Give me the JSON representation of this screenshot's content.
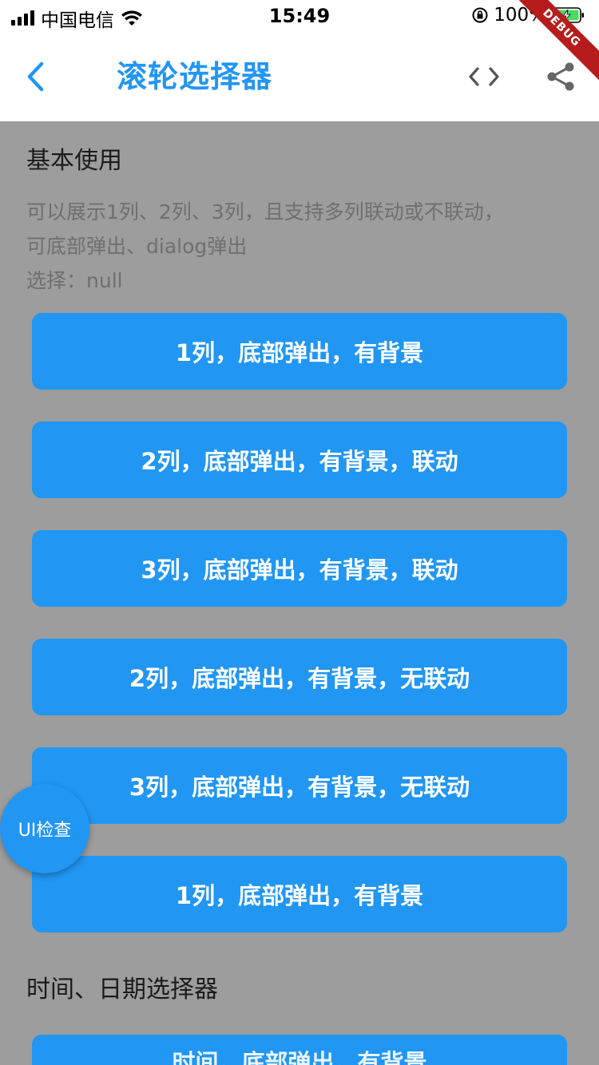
{
  "status": {
    "carrier": "中国电信",
    "time": "15:49",
    "battery": "100%"
  },
  "appbar": {
    "title": "滚轮选择器"
  },
  "debug_label": "DEBUG",
  "section_basic": {
    "title": "基本使用",
    "desc_line1": "可以展示1列、2列、3列，且支持多列联动或不联动，",
    "desc_line2": "可底部弹出、dialog弹出",
    "selection": "选择：null"
  },
  "buttons": [
    "1列，底部弹出，有背景",
    "2列，底部弹出，有背景，联动",
    "3列，底部弹出，有背景，联动",
    "2列，底部弹出，有背景，无联动",
    "3列，底部弹出，有背景，无联动",
    "1列，底部弹出，有背景"
  ],
  "section_time": {
    "title": "时间、日期选择器",
    "first_button": "时间，底部弹出，有背景"
  },
  "fab": {
    "label": "UI检查"
  },
  "colors": {
    "accent": "#2196f3",
    "overlay_bg": "#9d9d9d",
    "debug_ribbon": "#b71c1c"
  },
  "icons": {
    "back": "chevron-left-icon",
    "code": "code-icon",
    "share": "share-icon",
    "wifi": "wifi-icon",
    "signal": "signal-icon",
    "battery": "battery-charging-icon",
    "orientation_lock": "orientation-lock-icon"
  }
}
